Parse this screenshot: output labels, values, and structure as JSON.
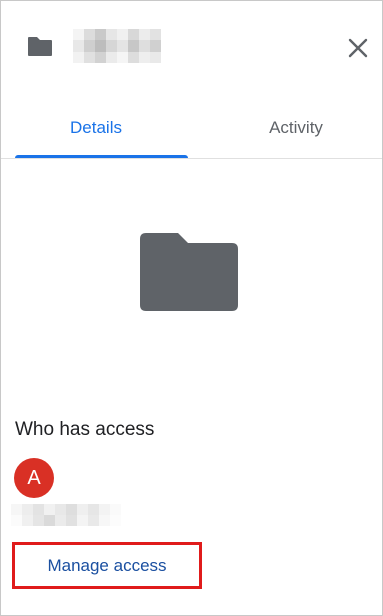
{
  "header": {
    "folder_icon": "folder-icon",
    "close_icon": "close-icon"
  },
  "tabs": [
    {
      "label": "Details",
      "active": true
    },
    {
      "label": "Activity",
      "active": false
    }
  ],
  "preview": {
    "icon": "folder-icon"
  },
  "access": {
    "heading": "Who has access",
    "avatar_letter": "A",
    "avatar_color": "#d93025",
    "manage_label": "Manage access"
  },
  "colors": {
    "accent": "#1a73e8",
    "icon_gray": "#5f6368",
    "highlight_border": "#e01b1b"
  }
}
